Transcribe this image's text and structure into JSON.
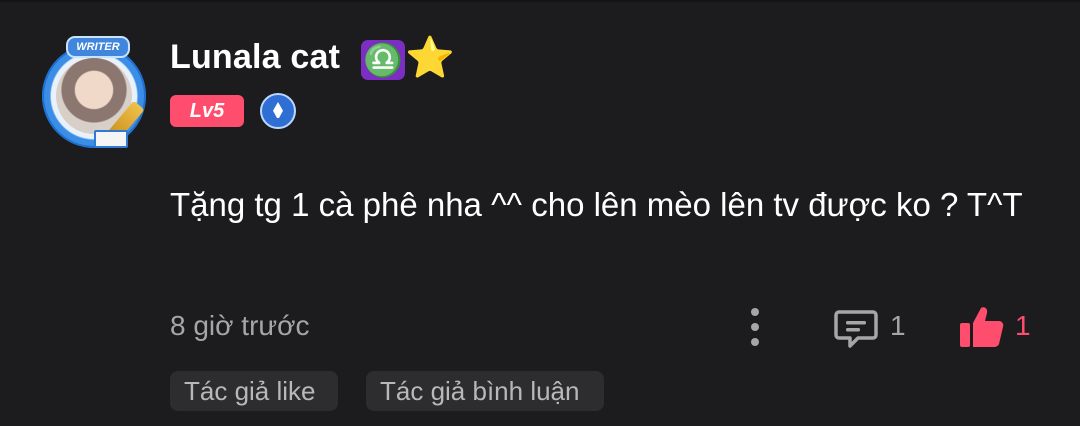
{
  "comment": {
    "username": "Lunala cat",
    "avatar_badge": "WRITER",
    "zodiac_symbol": "♎",
    "star_symbol": "⭐",
    "level": "Lv5",
    "text": "Tặng tg 1 cà phê nha ^^ cho lên mèo lên tv được ko ? T^T",
    "timestamp": "8 giờ trước",
    "reply_count": "1",
    "like_count": "1",
    "tags": [
      "Tác giả like",
      "Tác giả bình luận"
    ]
  },
  "colors": {
    "background": "#1c1c1e",
    "text": "#ffffff",
    "muted": "#a6a6a8",
    "accent": "#ff4d6e",
    "tag_bg": "#2d2d30"
  },
  "icons": {
    "avatar": "avatar-with-writer-frame",
    "zodiac": "libra-icon",
    "star": "star-icon",
    "badge": "pen-badge-icon",
    "more": "more-vertical-icon",
    "reply": "reply-icon",
    "like": "thumbs-up-icon"
  }
}
